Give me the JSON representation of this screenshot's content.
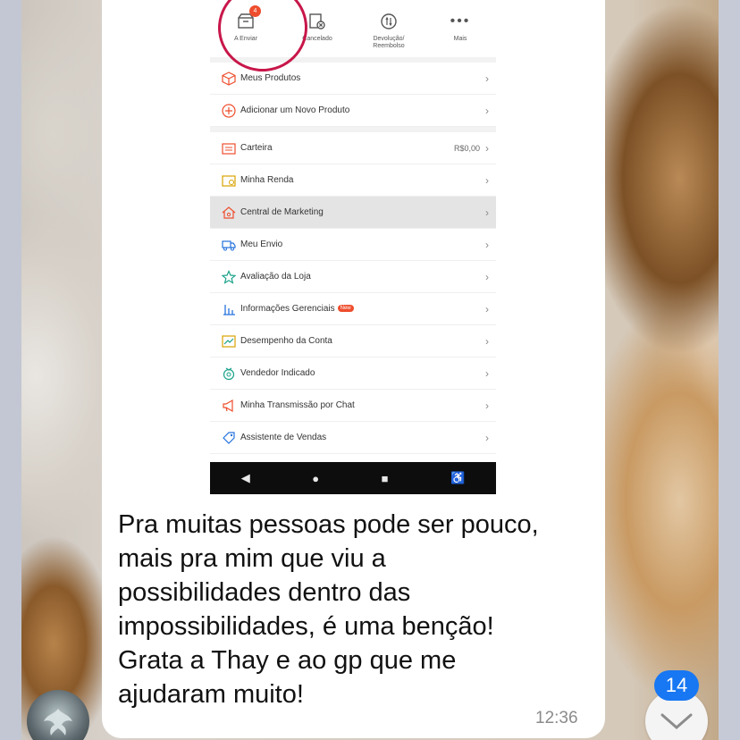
{
  "colors": {
    "bubble": "#ffffff",
    "accent": "#ee4d2d",
    "annotation_circle": "#c8174a",
    "unread_badge": "#1877f2",
    "android_navbar": "#0d0d0d"
  },
  "screenshot": {
    "status_tabs": [
      {
        "label": "A Enviar",
        "icon": "box-icon",
        "badge": "4"
      },
      {
        "label": "Cancelado",
        "icon": "cancel-doc-icon"
      },
      {
        "label": "Devolução/\nReembolso",
        "icon": "refund-icon"
      },
      {
        "label": "Mais",
        "icon": "more-dots-icon"
      }
    ],
    "menu_group_1": [
      {
        "label": "Meus Produtos",
        "icon": "cube-icon"
      },
      {
        "label": "Adicionar um Novo Produto",
        "icon": "plus-circle-icon"
      }
    ],
    "menu_group_2": [
      {
        "label": "Carteira",
        "icon": "wallet-icon",
        "value": "R$0,00"
      },
      {
        "label": "Minha Renda",
        "icon": "income-icon"
      },
      {
        "label": "Central de Marketing",
        "icon": "home-marketing-icon",
        "highlighted": true
      },
      {
        "label": "Meu Envio",
        "icon": "truck-icon"
      },
      {
        "label": "Avaliação da Loja",
        "icon": "star-icon"
      },
      {
        "label": "Informações Gerenciais",
        "icon": "bar-chart-icon",
        "tag": "New"
      },
      {
        "label": "Desempenho da Conta",
        "icon": "performance-icon"
      },
      {
        "label": "Vendedor Indicado",
        "icon": "medal-icon"
      },
      {
        "label": "Minha Transmissão por Chat",
        "icon": "megaphone-icon"
      },
      {
        "label": "Assistente de Vendas",
        "icon": "tag-icon"
      }
    ],
    "navbar": {
      "back": "◀",
      "home": "●",
      "recents": "■",
      "accessibility": "♿"
    }
  },
  "message": {
    "text": "Pra muitas pessoas pode ser pouco, mais pra mim que viu a possibilidades dentro das impossibilidades, é uma benção! Grata a Thay e ao gp que me ajudaram muito!",
    "lines": [
      "Pra muitas pessoas pode ser pouco,",
      "mais pra mim que viu a",
      "possibilidades dentro das",
      "impossibilidades, é uma benção!",
      "Grata a Thay e ao gp que me",
      "ajudaram muito!"
    ],
    "time": "12:36"
  },
  "unread_count": "14"
}
